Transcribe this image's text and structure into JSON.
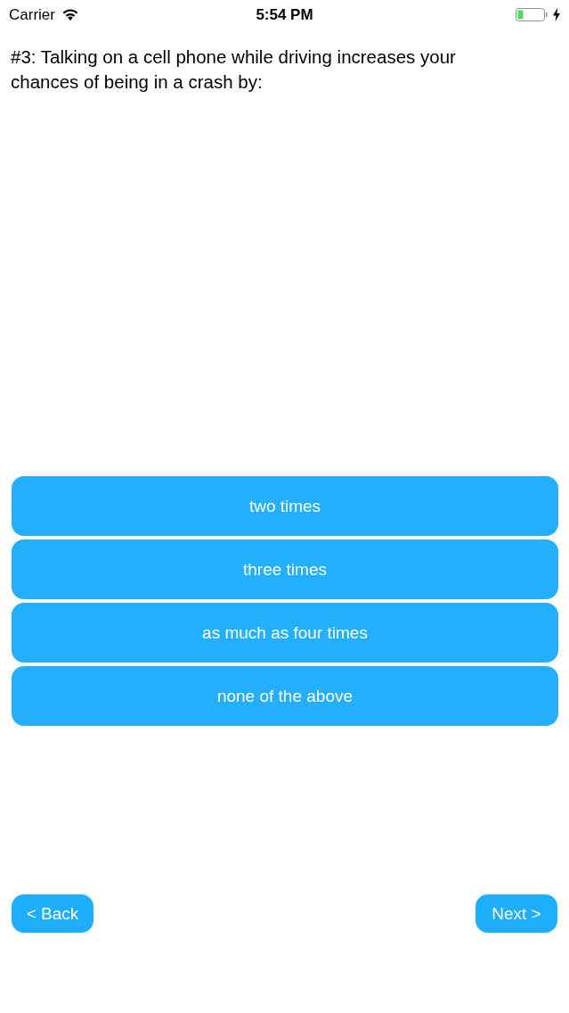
{
  "status_bar": {
    "carrier": "Carrier",
    "time": "5:54 PM",
    "charging": true
  },
  "question": "#3: Talking on a cell phone while driving increases your chances of being in a crash by:",
  "answers": [
    {
      "label": "two times"
    },
    {
      "label": "three times"
    },
    {
      "label": "as much as four times"
    },
    {
      "label": "none of the above"
    }
  ],
  "navigation": {
    "back": "< Back",
    "next": "Next >"
  }
}
